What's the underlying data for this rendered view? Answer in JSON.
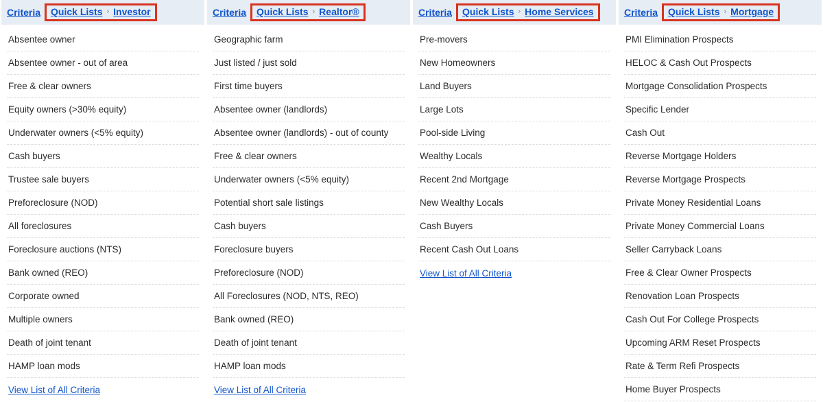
{
  "view_all_label": "View List of All Criteria",
  "breadcrumb_criteria_label": "Criteria",
  "breadcrumb_quicklists_label": "Quick Lists",
  "columns": [
    {
      "category": "Investor",
      "items": [
        "Absentee owner",
        "Absentee owner - out of area",
        "Free & clear owners",
        "Equity owners (>30% equity)",
        "Underwater owners (<5% equity)",
        "Cash buyers",
        "Trustee sale buyers",
        "Preforeclosure (NOD)",
        "All foreclosures",
        "Foreclosure auctions (NTS)",
        "Bank owned (REO)",
        "Corporate owned",
        "Multiple owners",
        "Death of joint tenant",
        "HAMP loan mods"
      ],
      "show_view_all": true
    },
    {
      "category": "Realtor®",
      "items": [
        "Geographic farm",
        "Just listed / just sold",
        "First time buyers",
        "Absentee owner (landlords)",
        "Absentee owner (landlords) - out of county",
        "Free & clear owners",
        "Underwater owners (<5% equity)",
        "Potential short sale listings",
        "Cash buyers",
        "Foreclosure buyers",
        "Preforeclosure (NOD)",
        "All Foreclosures (NOD, NTS, REO)",
        "Bank owned (REO)",
        "Death of joint tenant",
        "HAMP loan mods"
      ],
      "show_view_all": true
    },
    {
      "category": "Home Services",
      "items": [
        "Pre-movers",
        "New Homeowners",
        "Land Buyers",
        "Large Lots",
        "Pool-side Living",
        "Wealthy Locals",
        "Recent 2nd Mortgage",
        "New Wealthy Locals",
        "Cash Buyers",
        "Recent Cash Out Loans"
      ],
      "show_view_all": true
    },
    {
      "category": "Mortgage",
      "items": [
        "PMI Elimination Prospects",
        "HELOC & Cash Out Prospects",
        "Mortgage Consolidation Prospects",
        "Specific Lender",
        "Cash Out",
        "Reverse Mortgage Holders",
        "Reverse Mortgage Prospects",
        "Private Money Residential Loans",
        "Private Money Commercial Loans",
        "Seller Carryback Loans",
        "Free & Clear Owner Prospects",
        "Renovation Loan Prospects",
        "Cash Out For College Prospects",
        "Upcoming ARM Reset Prospects",
        "Rate & Term Refi Prospects",
        "Home Buyer Prospects"
      ],
      "show_view_all": false
    }
  ]
}
